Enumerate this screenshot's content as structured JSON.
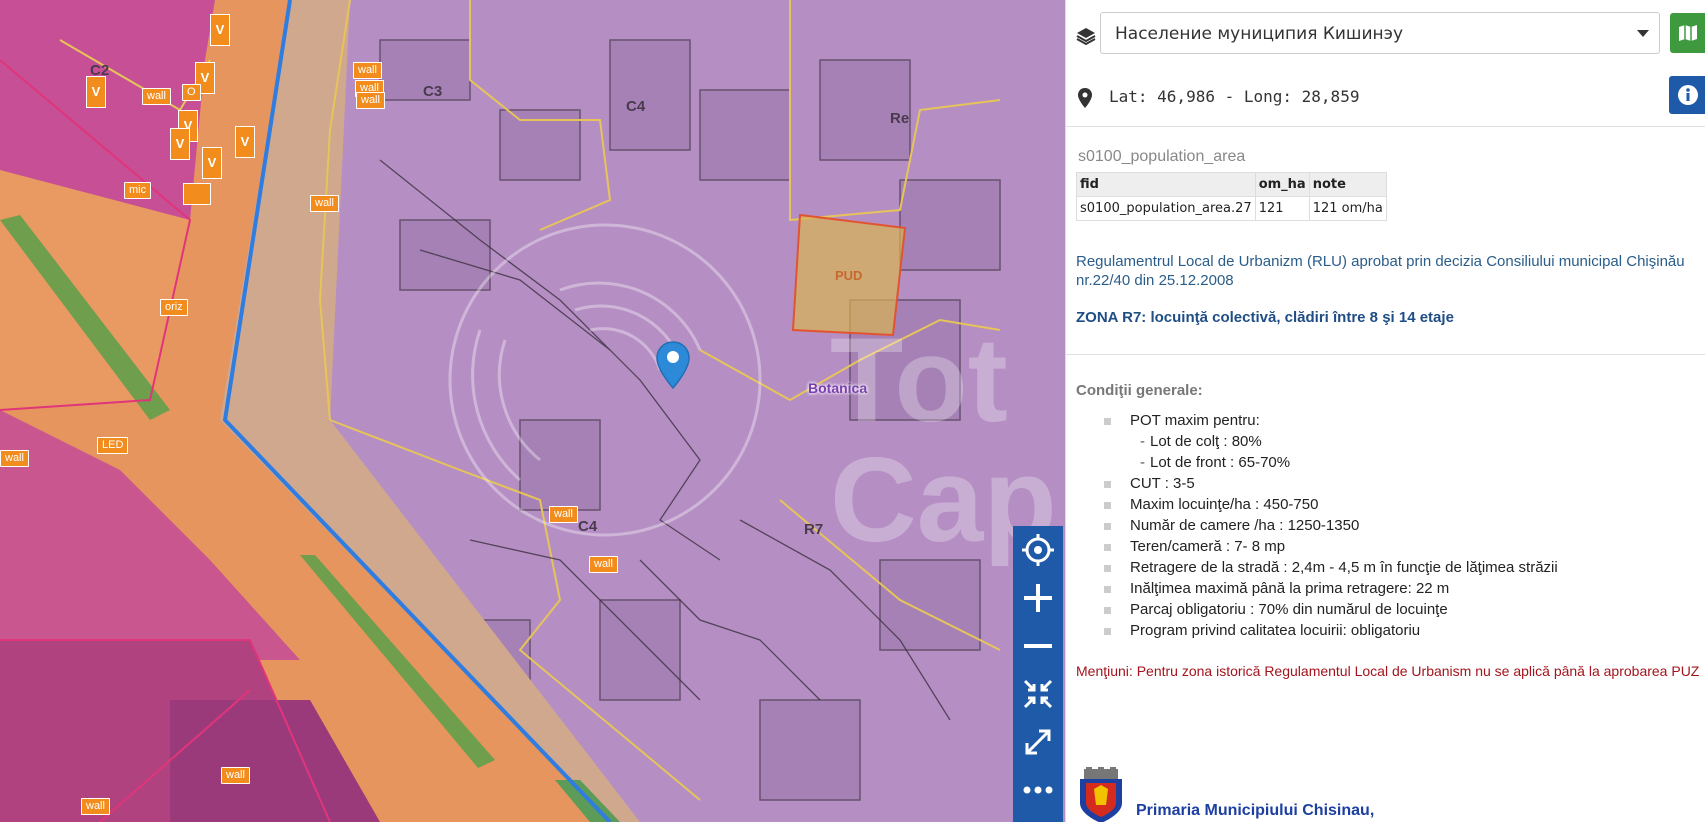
{
  "map": {
    "zones": {
      "c2": "C2",
      "c3": "C3",
      "c4_top": "C4",
      "re": "Re",
      "pud": "PUD",
      "c4_mid": "C4",
      "r7": "R7"
    },
    "place_label": "Botanica",
    "watermark": [
      "Tot",
      "Cap"
    ],
    "pois": {
      "wall": "wall",
      "mic": "mic",
      "oriz": "oriz",
      "led": "LED",
      "v": "V",
      "o": "O"
    },
    "controls": [
      "locate",
      "zoom-in",
      "zoom-out",
      "full-extent",
      "fullscreen",
      "more"
    ]
  },
  "layer": {
    "selected": "Население муниципия Кишинэу"
  },
  "coords": {
    "text": "Lat: 46,986 - Long: 28,859"
  },
  "feature": {
    "layer_name": "s0100_population_area",
    "table": {
      "headers": [
        "fid",
        "om_ha",
        "note"
      ],
      "rows": [
        [
          "s0100_population_area.27",
          "121",
          "121 om/ha"
        ]
      ]
    },
    "rlu": "Regulamentrul Local de Urbanizm (RLU) aprobat prin decizia Consiliului municipal Chişinău nr.22/40 din 25.12.2008",
    "zone_title": "ZONA R7: locuinţă colectivă, clădiri între 8 şi 14 etaje",
    "conditions_title": "Condiţii generale:",
    "conditions": [
      {
        "text": "POT maxim pentru:",
        "sub": false
      },
      {
        "text": "Lot de colţ : 80%",
        "sub": true
      },
      {
        "text": "Lot de front : 65-70%",
        "sub": true
      },
      {
        "text": "CUT : 3-5",
        "sub": false
      },
      {
        "text": "Maxim locuinţe/ha : 450-750",
        "sub": false
      },
      {
        "text": "Număr de camere /ha : 1250-1350",
        "sub": false
      },
      {
        "text": "Teren/cameră : 7- 8 mp",
        "sub": false
      },
      {
        "text": "Retragere de la stradă : 2,4m - 4,5 m în funcţie de lăţimea străzii",
        "sub": false
      },
      {
        "text": "Inălţimea maximă până la prima retragere: 22 m",
        "sub": false
      },
      {
        "text": "Parcaj obligatoriu : 70% din numărul de locuinţe",
        "sub": false
      },
      {
        "text": "Program privind calitatea locuirii: obligatoriu",
        "sub": false
      }
    ],
    "mentiuni_label": "Menţiuni:",
    "mentiuni_text": " Pentru zona istorică Regulamentul Local de Urbanism nu se aplică până la aprobarea PUZ",
    "footer": "Primaria Municipiului Chisinau,"
  },
  "colors": {
    "accent_blue": "#1e5aa8",
    "accent_green": "#3f9a3f",
    "zone_purple": "#b58fc4",
    "zone_orange": "#e5955d",
    "zone_magenta": "#c74f95",
    "boundary_yellow": "#e6c45a",
    "boundary_blue": "#2f7de1",
    "warning_red": "#a3141c"
  }
}
